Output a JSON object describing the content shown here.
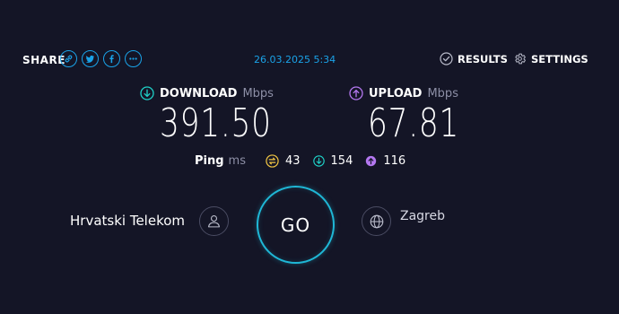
{
  "share": {
    "label": "SHARE",
    "buttons": [
      "link-icon",
      "twitter-icon",
      "facebook-icon",
      "more-icon"
    ]
  },
  "timestamp": "26.03.2025 5:34",
  "nav": {
    "results_label": "RESULTS",
    "settings_label": "SETTINGS"
  },
  "download": {
    "label": "DOWNLOAD",
    "unit": "Mbps",
    "value": "391.50",
    "color": "#1fd1c8"
  },
  "upload": {
    "label": "UPLOAD",
    "unit": "Mbps",
    "value": "67.81",
    "color": "#b478f0"
  },
  "ping": {
    "label": "Ping",
    "unit": "ms",
    "idle": "43",
    "download": "154",
    "upload": "116",
    "idle_color": "#f2c644"
  },
  "isp": {
    "name": "Hrvatski Telekom"
  },
  "server": {
    "name": "Zagreb"
  },
  "go_label": "GO",
  "colors": {
    "background": "#141526",
    "accent": "#1aa3e8",
    "go_ring": "#1fb7d6"
  }
}
